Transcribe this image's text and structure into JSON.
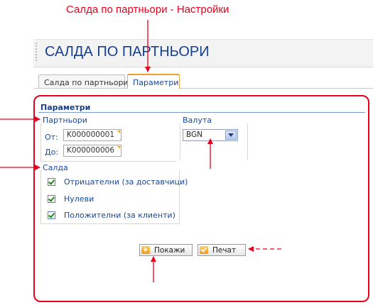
{
  "annotation": {
    "caption": "Салда по партньори - Настройки"
  },
  "header": {
    "title": "САЛДА ПО ПАРТНЬОРИ"
  },
  "tabs": [
    {
      "label": "Салда по партньори",
      "active": false
    },
    {
      "label": "Параметри",
      "active": true
    }
  ],
  "panel": {
    "title": "Параметри",
    "partners": {
      "label": "Партньори",
      "from_label": "От:",
      "from_value": "K000000001",
      "to_label": "До:",
      "to_value": "K000000006"
    },
    "currency": {
      "label": "Валута",
      "value": "BGN"
    },
    "saldo": {
      "label": "Салда",
      "options": [
        {
          "label": "Отрицателни (за доставчици)",
          "checked": true
        },
        {
          "label": "Нулеви",
          "checked": true
        },
        {
          "label": "Положителни (за клиенти)",
          "checked": true
        }
      ]
    },
    "buttons": {
      "show": "Покажи",
      "print": "Печат"
    }
  },
  "colors": {
    "accent": "#e8001c",
    "title_blue": "#173f8e",
    "label_blue": "#17479b",
    "tab_orange": "#f0a030"
  }
}
